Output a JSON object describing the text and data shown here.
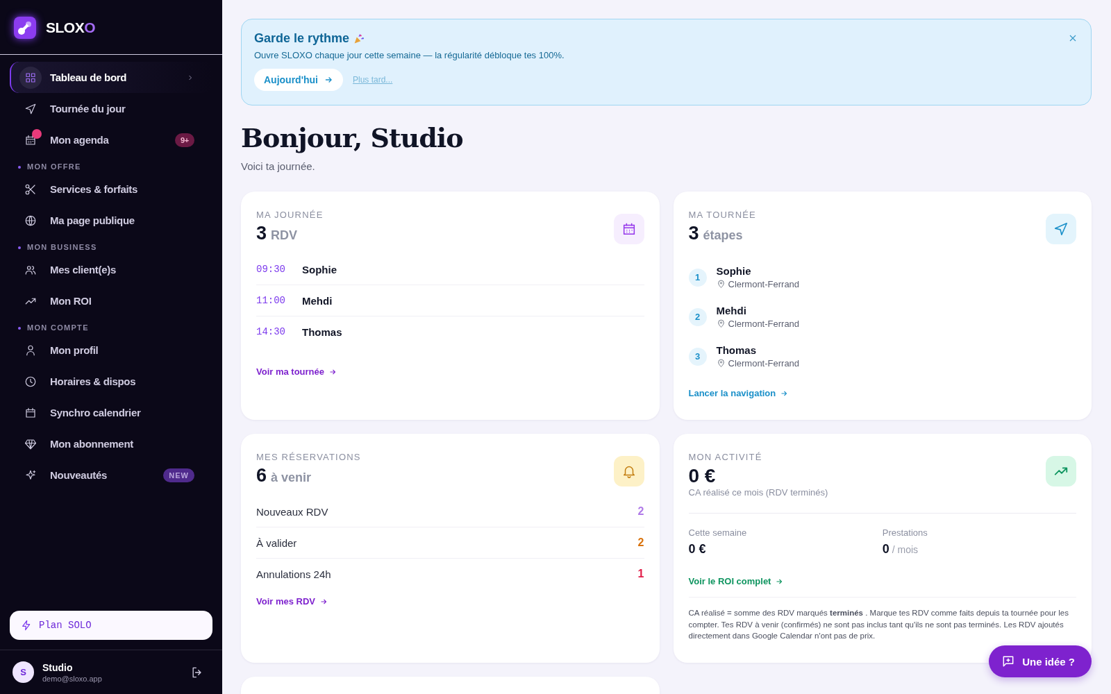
{
  "sidebar": {
    "brand": [
      {
        "text": "SLOX",
        "accent": false
      },
      {
        "text": "O",
        "accent": true
      }
    ],
    "nav": [
      {
        "kind": "link",
        "label": "Tableau de bord",
        "selected": true,
        "dot": false
      },
      {
        "kind": "link",
        "label": "Tournée du jour",
        "selected": false,
        "dot": false
      },
      {
        "kind": "link",
        "label": "Mon agenda",
        "selected": false,
        "dot": true,
        "badge": {
          "text": "9+",
          "kind": "alert"
        }
      },
      {
        "kind": "section",
        "label": "MON OFFRE"
      },
      {
        "kind": "link",
        "label": "Services & forfaits",
        "selected": false,
        "dot": false
      },
      {
        "kind": "link",
        "label": "Ma page publique",
        "selected": false,
        "dot": false
      },
      {
        "kind": "section",
        "label": "MON BUSINESS"
      },
      {
        "kind": "link",
        "label": "Mes client(e)s",
        "selected": false,
        "dot": false
      },
      {
        "kind": "link",
        "label": "Mon ROI",
        "selected": false,
        "dot": false
      },
      {
        "kind": "section",
        "label": "MON COMPTE"
      },
      {
        "kind": "link",
        "label": "Mon profil",
        "selected": false,
        "dot": false
      },
      {
        "kind": "link",
        "label": "Horaires & dispos",
        "selected": false,
        "dot": false
      },
      {
        "kind": "link",
        "label": "Synchro calendrier",
        "selected": false,
        "dot": false
      },
      {
        "kind": "link",
        "label": "Mon abonnement",
        "selected": false,
        "dot": false
      },
      {
        "kind": "link",
        "label": "Nouveautés",
        "selected": false,
        "dot": false,
        "badge": {
          "text": "NEW",
          "kind": "new"
        }
      }
    ],
    "plan": "Plan SOLO",
    "user": {
      "initial": "S",
      "name": "Studio",
      "email": "demo@sloxo.app"
    }
  },
  "banner": {
    "title": "Garde le rythme",
    "text": "Ouvre SLOXO chaque jour cette semaine — la régularité débloque tes 100%.",
    "primary": "Aujourd'hui",
    "secondary": "Plus tard..."
  },
  "greeting": {
    "title": "Bonjour, Studio",
    "subtitle": "Voici ta journée."
  },
  "journee": {
    "label": "MA JOURNÉE",
    "count": "3",
    "unit": "RDV",
    "rows": [
      {
        "time": "09:30",
        "name": "Sophie"
      },
      {
        "time": "11:00",
        "name": "Mehdi"
      },
      {
        "time": "14:30",
        "name": "Thomas"
      }
    ],
    "link": "Voir ma tournée"
  },
  "tournee": {
    "label": "MA TOURNÉE",
    "count": "3",
    "unit": "étapes",
    "stops": [
      {
        "number": "1",
        "name": "Sophie",
        "city": "Clermont-Ferrand"
      },
      {
        "number": "2",
        "name": "Mehdi",
        "city": "Clermont-Ferrand"
      },
      {
        "number": "3",
        "name": "Thomas",
        "city": "Clermont-Ferrand"
      }
    ],
    "link": "Lancer la navigation"
  },
  "reservations": {
    "label": "MES RÉSERVATIONS",
    "count": "6",
    "unit": "à venir",
    "rows": [
      {
        "label": "Nouveaux RDV",
        "value": "2",
        "color": "#b07ae8"
      },
      {
        "label": "À valider",
        "value": "2",
        "color": "#d9730d"
      },
      {
        "label": "Annulations 24h",
        "value": "1",
        "color": "#e11d48"
      }
    ],
    "link": "Voir mes RDV"
  },
  "activite": {
    "label": "MON ACTIVITÉ",
    "amount": "0 €",
    "caption": "CA réalisé ce mois (RDV terminés)",
    "stats": [
      {
        "label": "Cette semaine",
        "value": "0 €"
      },
      {
        "label": "Prestations",
        "value": "0",
        "unit": "/ mois"
      }
    ],
    "link": "Voir le ROI complet",
    "note": "CA réalisé = somme des RDV marqués **terminés** . Marque tes RDV comme faits depuis ta tournée pour les compter. Tes RDV à venir (confirmés) ne sont pas inclus tant qu'ils ne sont pas terminés. Les RDV ajoutés directement dans Google Calendar n'ont pas de prix."
  },
  "feedback_button": "Une idée ?"
}
